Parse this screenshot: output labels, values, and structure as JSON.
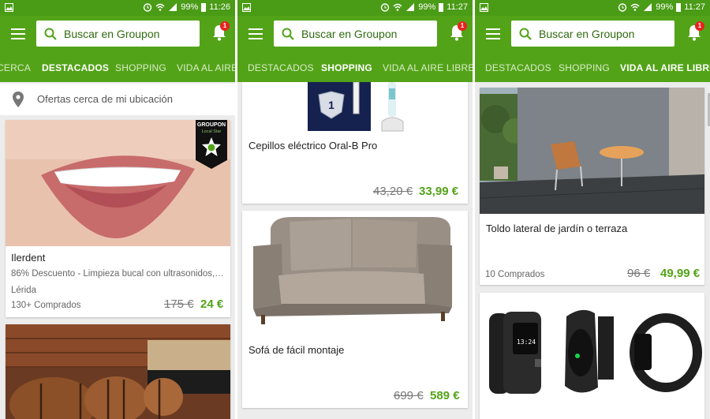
{
  "search": {
    "label": "Buscar en Groupon"
  },
  "notifications": {
    "count": "1"
  },
  "panels": [
    {
      "status": {
        "battery": "99%",
        "time": "11:26"
      },
      "tabs": [
        "CERCA",
        "DESTACADOS",
        "SHOPPING",
        "VIDA AL AIRE LIBRE"
      ],
      "active_tab": "DESTACADOS",
      "location_text": "Ofertas cerca de mi ubicación",
      "deals": [
        {
          "title": "Ilerdent",
          "description": "86% Descuento - Limpieza bucal con ultrasonidos, ...",
          "city": "Lérida",
          "purchased": "130+ Comprados",
          "old_price": "175 €",
          "new_price": "24 €",
          "stamp_brand": "GROUPON",
          "stamp_sub": "Local Star"
        }
      ]
    },
    {
      "status": {
        "battery": "99%",
        "time": "11:27"
      },
      "tabs": [
        "DESTACADOS",
        "SHOPPING",
        "VIDA AL AIRE LIBRE"
      ],
      "active_tab": "SHOPPING",
      "deals": [
        {
          "title": "Cepillos eléctrico Oral-B Pro",
          "old_price": "43,20 €",
          "new_price": "33,99 €"
        },
        {
          "title": "Sofá de fácil montaje",
          "old_price": "699 €",
          "new_price": "589 €"
        }
      ]
    },
    {
      "status": {
        "battery": "99%",
        "time": "11:27"
      },
      "tabs": [
        "DESTACADOS",
        "SHOPPING",
        "VIDA AL AIRE LIBRE"
      ],
      "active_tab": "VIDA AL AIRE LIBRE",
      "deals": [
        {
          "title": "Toldo lateral de jardín o terraza",
          "purchased": "10 Comprados",
          "old_price": "96 €",
          "new_price": "49,99 €"
        },
        {
          "smartwatch_screen_text": "13:24"
        }
      ]
    }
  ],
  "colors": {
    "primary_green": "#53a318",
    "status_green": "#4a9b16",
    "price_green": "#53a318",
    "badge_red": "#e8231f"
  }
}
